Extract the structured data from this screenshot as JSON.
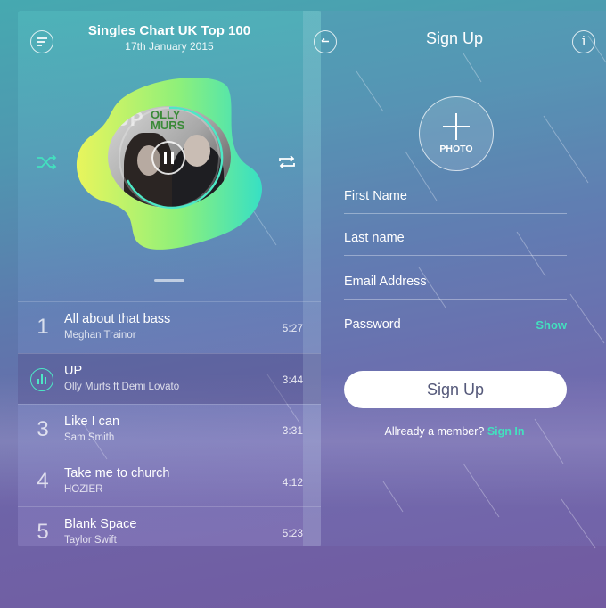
{
  "colors": {
    "accent": "#43e0be",
    "button_text": "#55597a"
  },
  "player": {
    "chart_title": "Singles Chart UK Top 100",
    "chart_date": "17th January 2015",
    "album_art_text": {
      "line1": "UP",
      "line2": "OLLY",
      "line3": "MURS"
    },
    "icons": {
      "menu": "menu-icon",
      "shuffle": "shuffle-icon",
      "repeat": "repeat-icon",
      "pause": "pause-icon",
      "equalizer": "equalizer-icon"
    }
  },
  "tracks": [
    {
      "number": "1",
      "title": "All about that bass",
      "artist": "Meghan Trainor",
      "duration": "5:27"
    },
    {
      "number": "",
      "title": "UP",
      "artist": "Olly Murfs ft Demi Lovato",
      "duration": "3:44"
    },
    {
      "number": "3",
      "title": "Like I can",
      "artist": "Sam Smith",
      "duration": "3:31"
    },
    {
      "number": "4",
      "title": "Take me to church",
      "artist": "HOZIER",
      "duration": "4:12"
    },
    {
      "number": "5",
      "title": "Blank Space",
      "artist": "Taylor Swift",
      "duration": "5:23"
    }
  ],
  "signup": {
    "title": "Sign Up",
    "photo_label": "PHOTO",
    "info_icon_glyph": "i",
    "fields": {
      "first_name": "First Name",
      "last_name": "Last name",
      "email": "Email Address",
      "password": "Password",
      "show_label": "Show"
    },
    "submit_label": "Sign Up",
    "already_member": "Allready a member?",
    "sign_in_link": "Sign In"
  }
}
